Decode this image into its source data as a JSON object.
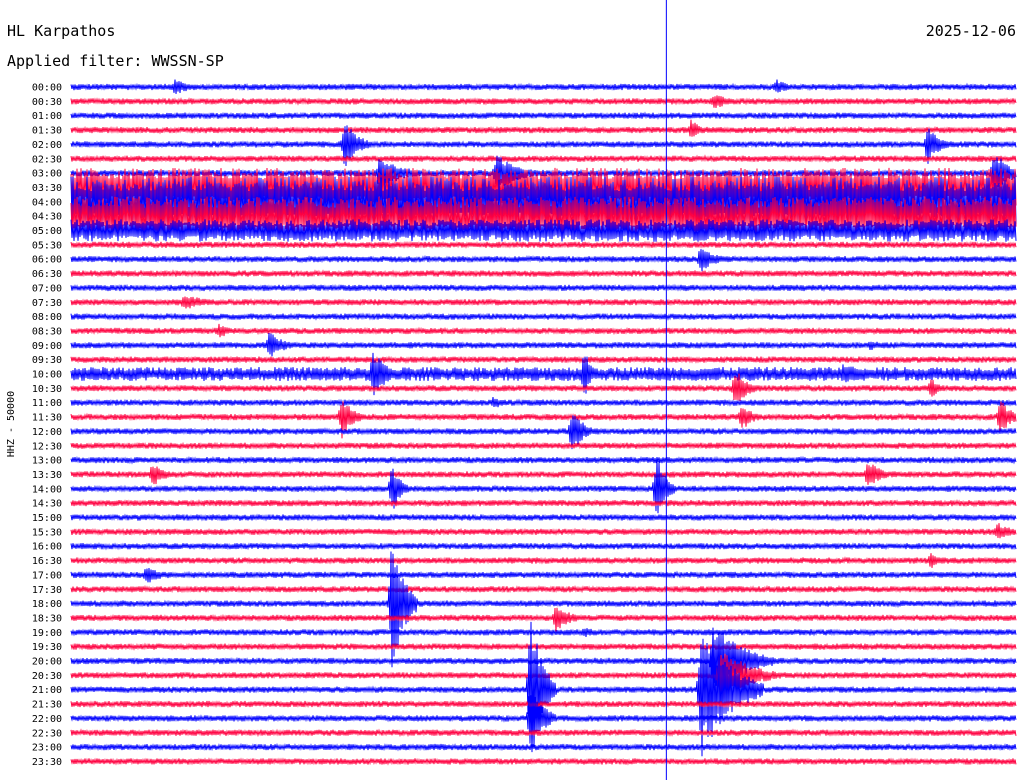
{
  "header": {
    "station": "HL Karpathos",
    "date": "2025-12-06",
    "filter": "Applied filter: WWSSN-SP"
  },
  "chart_data": {
    "type": "helicorder",
    "ylabel": "HHZ - 50000",
    "trace_colors": [
      "#0000ff",
      "#ff0040"
    ],
    "rows": [
      "00:00",
      "00:30",
      "01:00",
      "01:30",
      "02:00",
      "02:30",
      "03:00",
      "03:30",
      "04:00",
      "04:30",
      "05:00",
      "05:30",
      "06:00",
      "06:30",
      "07:00",
      "07:30",
      "08:00",
      "08:30",
      "09:00",
      "09:30",
      "10:00",
      "10:30",
      "11:00",
      "11:30",
      "12:00",
      "12:30",
      "13:00",
      "13:30",
      "14:00",
      "14:30",
      "15:00",
      "15:30",
      "16:00",
      "16:30",
      "17:00",
      "17:30",
      "18:00",
      "18:30",
      "19:00",
      "19:30",
      "20:00",
      "20:30",
      "21:00",
      "21:30",
      "22:00",
      "22:30",
      "23:00",
      "23:30"
    ],
    "current_time_marker": {
      "minute": 18.9,
      "color": "#0000ff"
    },
    "events": [
      {
        "row": 0,
        "minute": 3.3,
        "amplitude": 8,
        "duration": 1.2
      },
      {
        "row": 0,
        "minute": 22.4,
        "amplitude": 8,
        "duration": 1.0
      },
      {
        "row": 1,
        "minute": 20.4,
        "amplitude": 9,
        "duration": 1.0
      },
      {
        "row": 3,
        "minute": 19.7,
        "amplitude": 12,
        "duration": 0.6
      },
      {
        "row": 4,
        "minute": 8.7,
        "amplitude": 30,
        "duration": 0.8
      },
      {
        "row": 4,
        "minute": 27.2,
        "amplitude": 20,
        "duration": 0.8
      },
      {
        "row": 6,
        "minute": 9.8,
        "amplitude": 18,
        "duration": 1.5
      },
      {
        "row": 6,
        "minute": 13.5,
        "amplitude": 20,
        "duration": 1.5
      },
      {
        "row": 6,
        "minute": 29.3,
        "amplitude": 24,
        "duration": 1.0
      },
      {
        "row": 9,
        "minute": 18.5,
        "amplitude": 18,
        "duration": 1.5
      },
      {
        "row": 12,
        "minute": 20.0,
        "amplitude": 14,
        "duration": 1.0
      },
      {
        "row": 15,
        "minute": 3.6,
        "amplitude": 9,
        "duration": 1.5
      },
      {
        "row": 17,
        "minute": 4.7,
        "amplitude": 8,
        "duration": 0.8
      },
      {
        "row": 18,
        "minute": 6.3,
        "amplitude": 14,
        "duration": 1.0
      },
      {
        "row": 18,
        "minute": 25.4,
        "amplitude": 6,
        "duration": 0.8
      },
      {
        "row": 20,
        "minute": 9.6,
        "amplitude": 28,
        "duration": 0.8
      },
      {
        "row": 20,
        "minute": 16.3,
        "amplitude": 26,
        "duration": 0.5
      },
      {
        "row": 20,
        "minute": 24.5,
        "amplitude": 10,
        "duration": 2.5
      },
      {
        "row": 21,
        "minute": 21.1,
        "amplitude": 20,
        "duration": 0.8
      },
      {
        "row": 21,
        "minute": 27.3,
        "amplitude": 12,
        "duration": 0.5
      },
      {
        "row": 22,
        "minute": 13.4,
        "amplitude": 7,
        "duration": 0.8
      },
      {
        "row": 23,
        "minute": 8.6,
        "amplitude": 22,
        "duration": 0.8
      },
      {
        "row": 23,
        "minute": 21.3,
        "amplitude": 14,
        "duration": 0.8
      },
      {
        "row": 23,
        "minute": 29.5,
        "amplitude": 18,
        "duration": 0.8
      },
      {
        "row": 24,
        "minute": 15.9,
        "amplitude": 24,
        "duration": 0.8
      },
      {
        "row": 27,
        "minute": 2.6,
        "amplitude": 14,
        "duration": 0.8
      },
      {
        "row": 27,
        "minute": 25.3,
        "amplitude": 14,
        "duration": 1.0
      },
      {
        "row": 28,
        "minute": 10.2,
        "amplitude": 26,
        "duration": 0.6
      },
      {
        "row": 28,
        "minute": 18.6,
        "amplitude": 40,
        "duration": 0.6
      },
      {
        "row": 31,
        "minute": 29.4,
        "amplitude": 10,
        "duration": 1.0
      },
      {
        "row": 33,
        "minute": 27.3,
        "amplitude": 8,
        "duration": 1.0
      },
      {
        "row": 34,
        "minute": 2.4,
        "amplitude": 10,
        "duration": 1.0
      },
      {
        "row": 36,
        "minute": 10.2,
        "amplitude": 75,
        "duration": 0.8
      },
      {
        "row": 37,
        "minute": 15.4,
        "amplitude": 14,
        "duration": 1.0
      },
      {
        "row": 38,
        "minute": 16.3,
        "amplitude": 6,
        "duration": 0.8
      },
      {
        "row": 40,
        "minute": 20.4,
        "amplitude": 40,
        "duration": 2.0
      },
      {
        "row": 41,
        "minute": 20.6,
        "amplitude": 30,
        "duration": 2.0
      },
      {
        "row": 42,
        "minute": 14.6,
        "amplitude": 80,
        "duration": 0.8
      },
      {
        "row": 42,
        "minute": 20.0,
        "amplitude": 70,
        "duration": 2.0
      },
      {
        "row": 44,
        "minute": 14.6,
        "amplitude": 40,
        "duration": 0.8
      }
    ],
    "noisy_rows": [
      {
        "row": 7,
        "level": 14
      },
      {
        "row": 8,
        "level": 18
      },
      {
        "row": 9,
        "level": 14
      },
      {
        "row": 10,
        "level": 8
      },
      {
        "row": 20,
        "level": 5
      }
    ]
  }
}
